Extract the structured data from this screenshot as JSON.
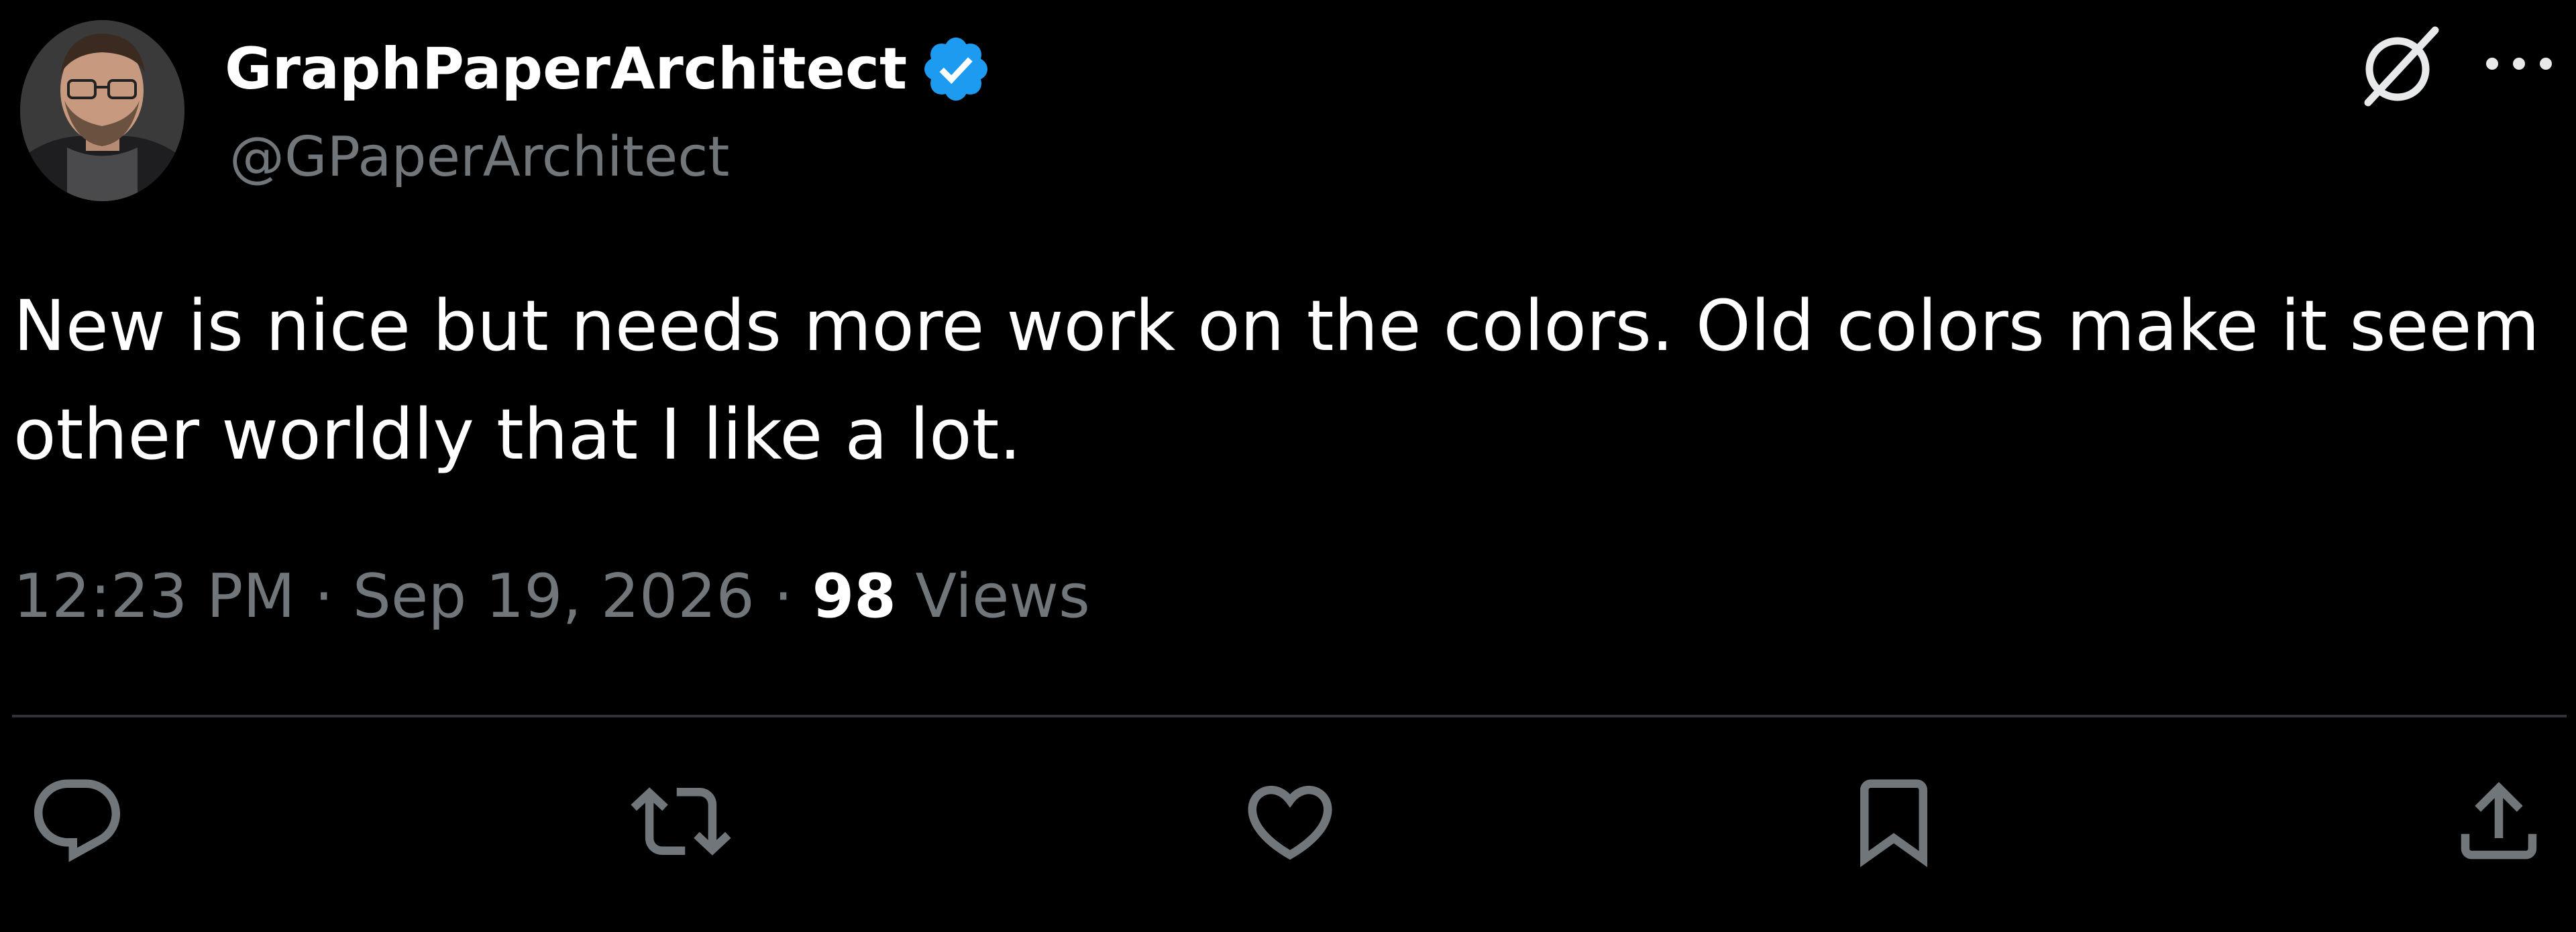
{
  "author": {
    "name": "GraphPaperArchitect",
    "handle": "@GPaperArchitect",
    "verified_color": "#1d9bf0"
  },
  "tweet": {
    "text": "New is nice but needs more work on the colors.  Old colors make it seem other worldly that I like a lot.",
    "time": "12:23 PM",
    "separator": "·",
    "date": "Sep 19, 2026",
    "views_count": "98",
    "views_label": "Views"
  },
  "header_icons": [
    "grok-icon",
    "more-icon"
  ],
  "actions": [
    "reply-icon",
    "retweet-icon",
    "like-icon",
    "bookmark-icon",
    "share-icon"
  ],
  "colors": {
    "background": "#000000",
    "primary_text": "#ffffff",
    "secondary_text": "#71767b",
    "divider": "#2f3336"
  }
}
